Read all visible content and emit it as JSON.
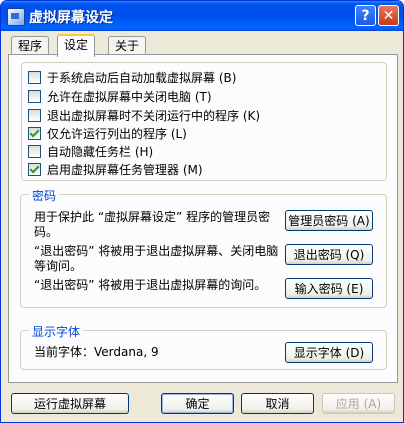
{
  "window": {
    "title": "虚拟屏幕设定"
  },
  "titlebar_buttons": {
    "help": "?",
    "close": "✕"
  },
  "tabs": [
    {
      "label": "程序"
    },
    {
      "label": "设定"
    },
    {
      "label": "关于"
    }
  ],
  "options": [
    {
      "label": "于系统启动后自动加载虚拟屏幕 (B)",
      "checked": false
    },
    {
      "label": "允许在虚拟屏幕中关闭电脑 (T)",
      "checked": false
    },
    {
      "label": "退出虚拟屏幕时不关闭运行中的程序 (K)",
      "checked": false
    },
    {
      "label": "仅允许运行列出的程序 (L)",
      "checked": true
    },
    {
      "label": "自动隐藏任务栏 (H)",
      "checked": false
    },
    {
      "label": "启用虚拟屏幕任务管理器 (M)",
      "checked": true
    }
  ],
  "password_group": {
    "title": "密码",
    "admin_text": "用于保护此 “虚拟屏幕设定” 程序的管理员密码。",
    "admin_button": "管理员密码 (A)",
    "exit_text": "“退出密码” 将被用于退出虚拟屏幕、关闭电脑等询问。",
    "exit_button": "退出密码 (Q)",
    "input_text": "“退出密码” 将被用于退出虚拟屏幕的询问。",
    "input_button": "输入密码 (E)"
  },
  "font_group": {
    "title": "显示字体",
    "current_font": "当前字体：Verdana, 9",
    "font_button": "显示字体 (D)"
  },
  "footer": {
    "run_button": "运行虚拟屏幕",
    "ok_button": "确定",
    "cancel_button": "取消",
    "apply_button": "应用 (A)"
  }
}
